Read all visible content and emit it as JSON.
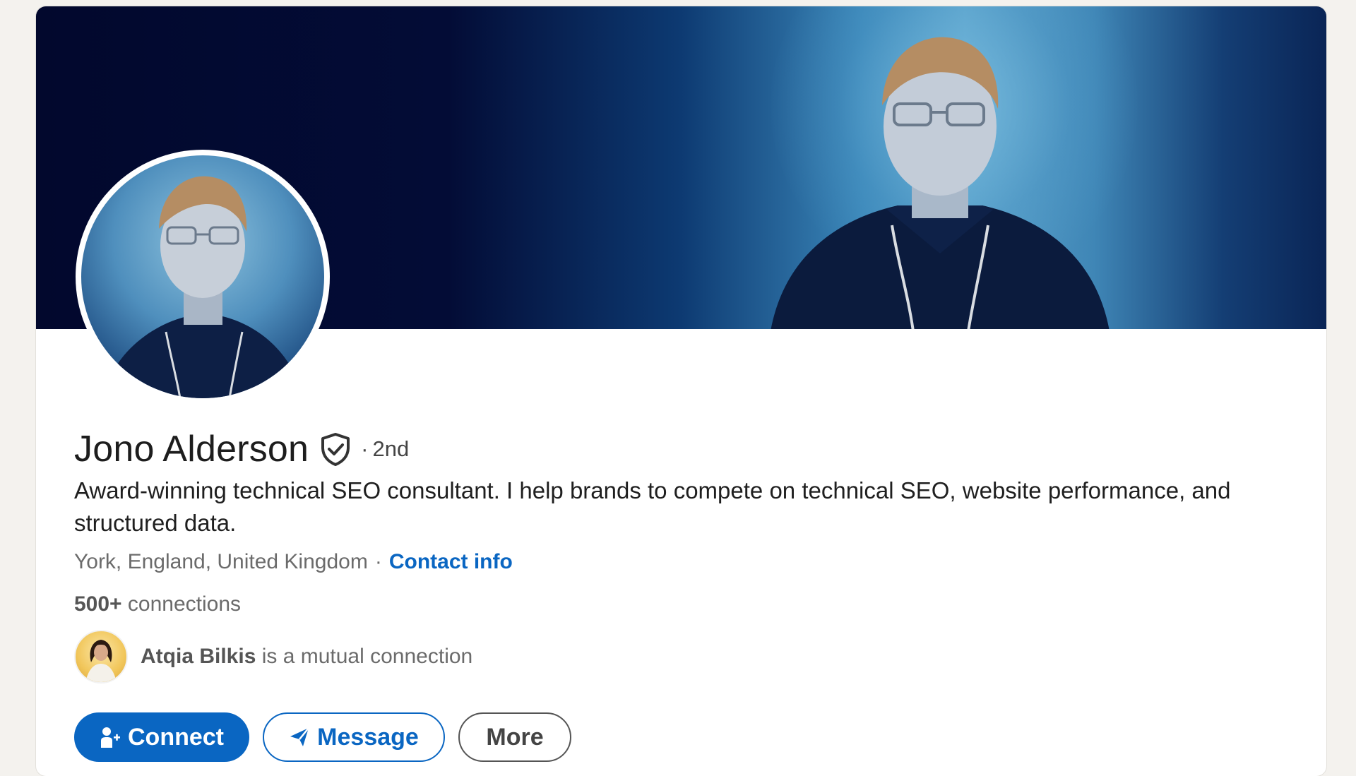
{
  "profile": {
    "name": "Jono Alderson",
    "degree": "2nd",
    "degree_separator": "·",
    "headline": "Award-winning technical SEO consultant. I help brands to compete on technical SEO, website performance, and structured data.",
    "location": "York, England, United Kingdom",
    "location_separator": "·",
    "contact_info_label": "Contact info",
    "connections_count": "500+",
    "connections_label": "connections",
    "verified_icon": "verified-shield-check-icon"
  },
  "mutual": {
    "name": "Atqia Bilkis",
    "text": "is a mutual connection"
  },
  "actions": {
    "connect_label": "Connect",
    "connect_icon": "person-add-icon",
    "message_label": "Message",
    "message_icon": "send-icon",
    "more_label": "More"
  },
  "colors": {
    "primary": "#0a66c2",
    "page_background": "#f4f2ee",
    "banner_dark": "#02082d",
    "banner_light": "#5da4cc"
  }
}
